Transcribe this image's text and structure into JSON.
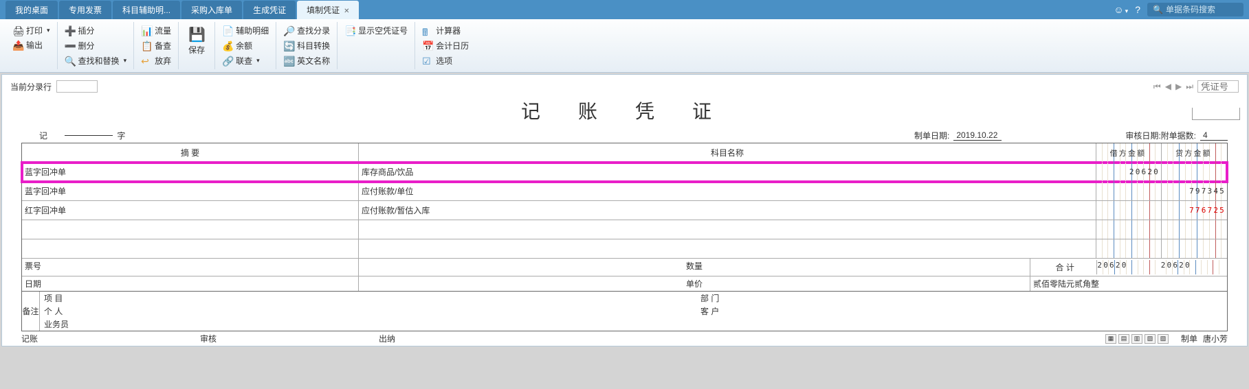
{
  "tabs": [
    "我的桌面",
    "专用发票",
    "科目辅助明...",
    "采购入库单",
    "生成凭证",
    "填制凭证"
  ],
  "active_tab_index": 5,
  "search_placeholder": "单据条码搜索",
  "ribbon": {
    "print": "打印",
    "output": "输出",
    "insert": "插分",
    "delete": "删分",
    "find_replace": "查找和替换",
    "dd": "▾",
    "flow": "流量",
    "review": "备查",
    "abandon": "放弃",
    "save": "保存",
    "aux_detail": "辅助明细",
    "balance": "余额",
    "assoc": "联查",
    "find_entry": "查找分录",
    "acct_convert": "科目转换",
    "eng_name": "英文名称",
    "show_empty": "显示空凭证号",
    "calculator": "计算器",
    "calendar": "会计日历",
    "options": "选项"
  },
  "toprow": {
    "label": "当前分录行",
    "value": ""
  },
  "nav": {
    "voucher_no_placeholder": "凭证号"
  },
  "voucher": {
    "title": "记 账 凭 证",
    "type_label": "记",
    "word_label": "字",
    "date_label": "制单日期:",
    "date_value": "2019.10.22",
    "audit_date_label": "审核日期:",
    "attach_label": "附单据数:",
    "attach_value": "4",
    "head_summary": "摘 要",
    "head_account": "科目名称",
    "head_debit": "借方金额",
    "head_credit": "贷方金额",
    "rows": [
      {
        "summary": "蓝字回冲单",
        "account": "库存商品/饮品",
        "debit": "20620",
        "credit": ""
      },
      {
        "summary": "蓝字回冲单",
        "account": "应付账款/单位",
        "debit": "",
        "credit": "797345"
      },
      {
        "summary": "红字回冲单",
        "account": "应付账款/暂估入库",
        "debit": "",
        "credit": "776725",
        "credit_red": true
      },
      {
        "summary": "",
        "account": "",
        "debit": "",
        "credit": ""
      },
      {
        "summary": "",
        "account": "",
        "debit": "",
        "credit": ""
      }
    ],
    "bill_no_label": "票号",
    "bill_date_label": "日期",
    "qty_label": "数量",
    "price_label": "单价",
    "total_label": "合 计",
    "total_debit": "20620",
    "total_credit": "20620",
    "amount_words": "贰佰零陆元贰角整",
    "remark_label": "备注",
    "project_label": "项 目",
    "person_label": "个 人",
    "sales_label": "业务员",
    "dept_label": "部 门",
    "customer_label": "客 户",
    "sign_book": "记账",
    "sign_audit": "审核",
    "sign_cash": "出纳",
    "sign_make": "制单",
    "maker": "唐小芳"
  }
}
